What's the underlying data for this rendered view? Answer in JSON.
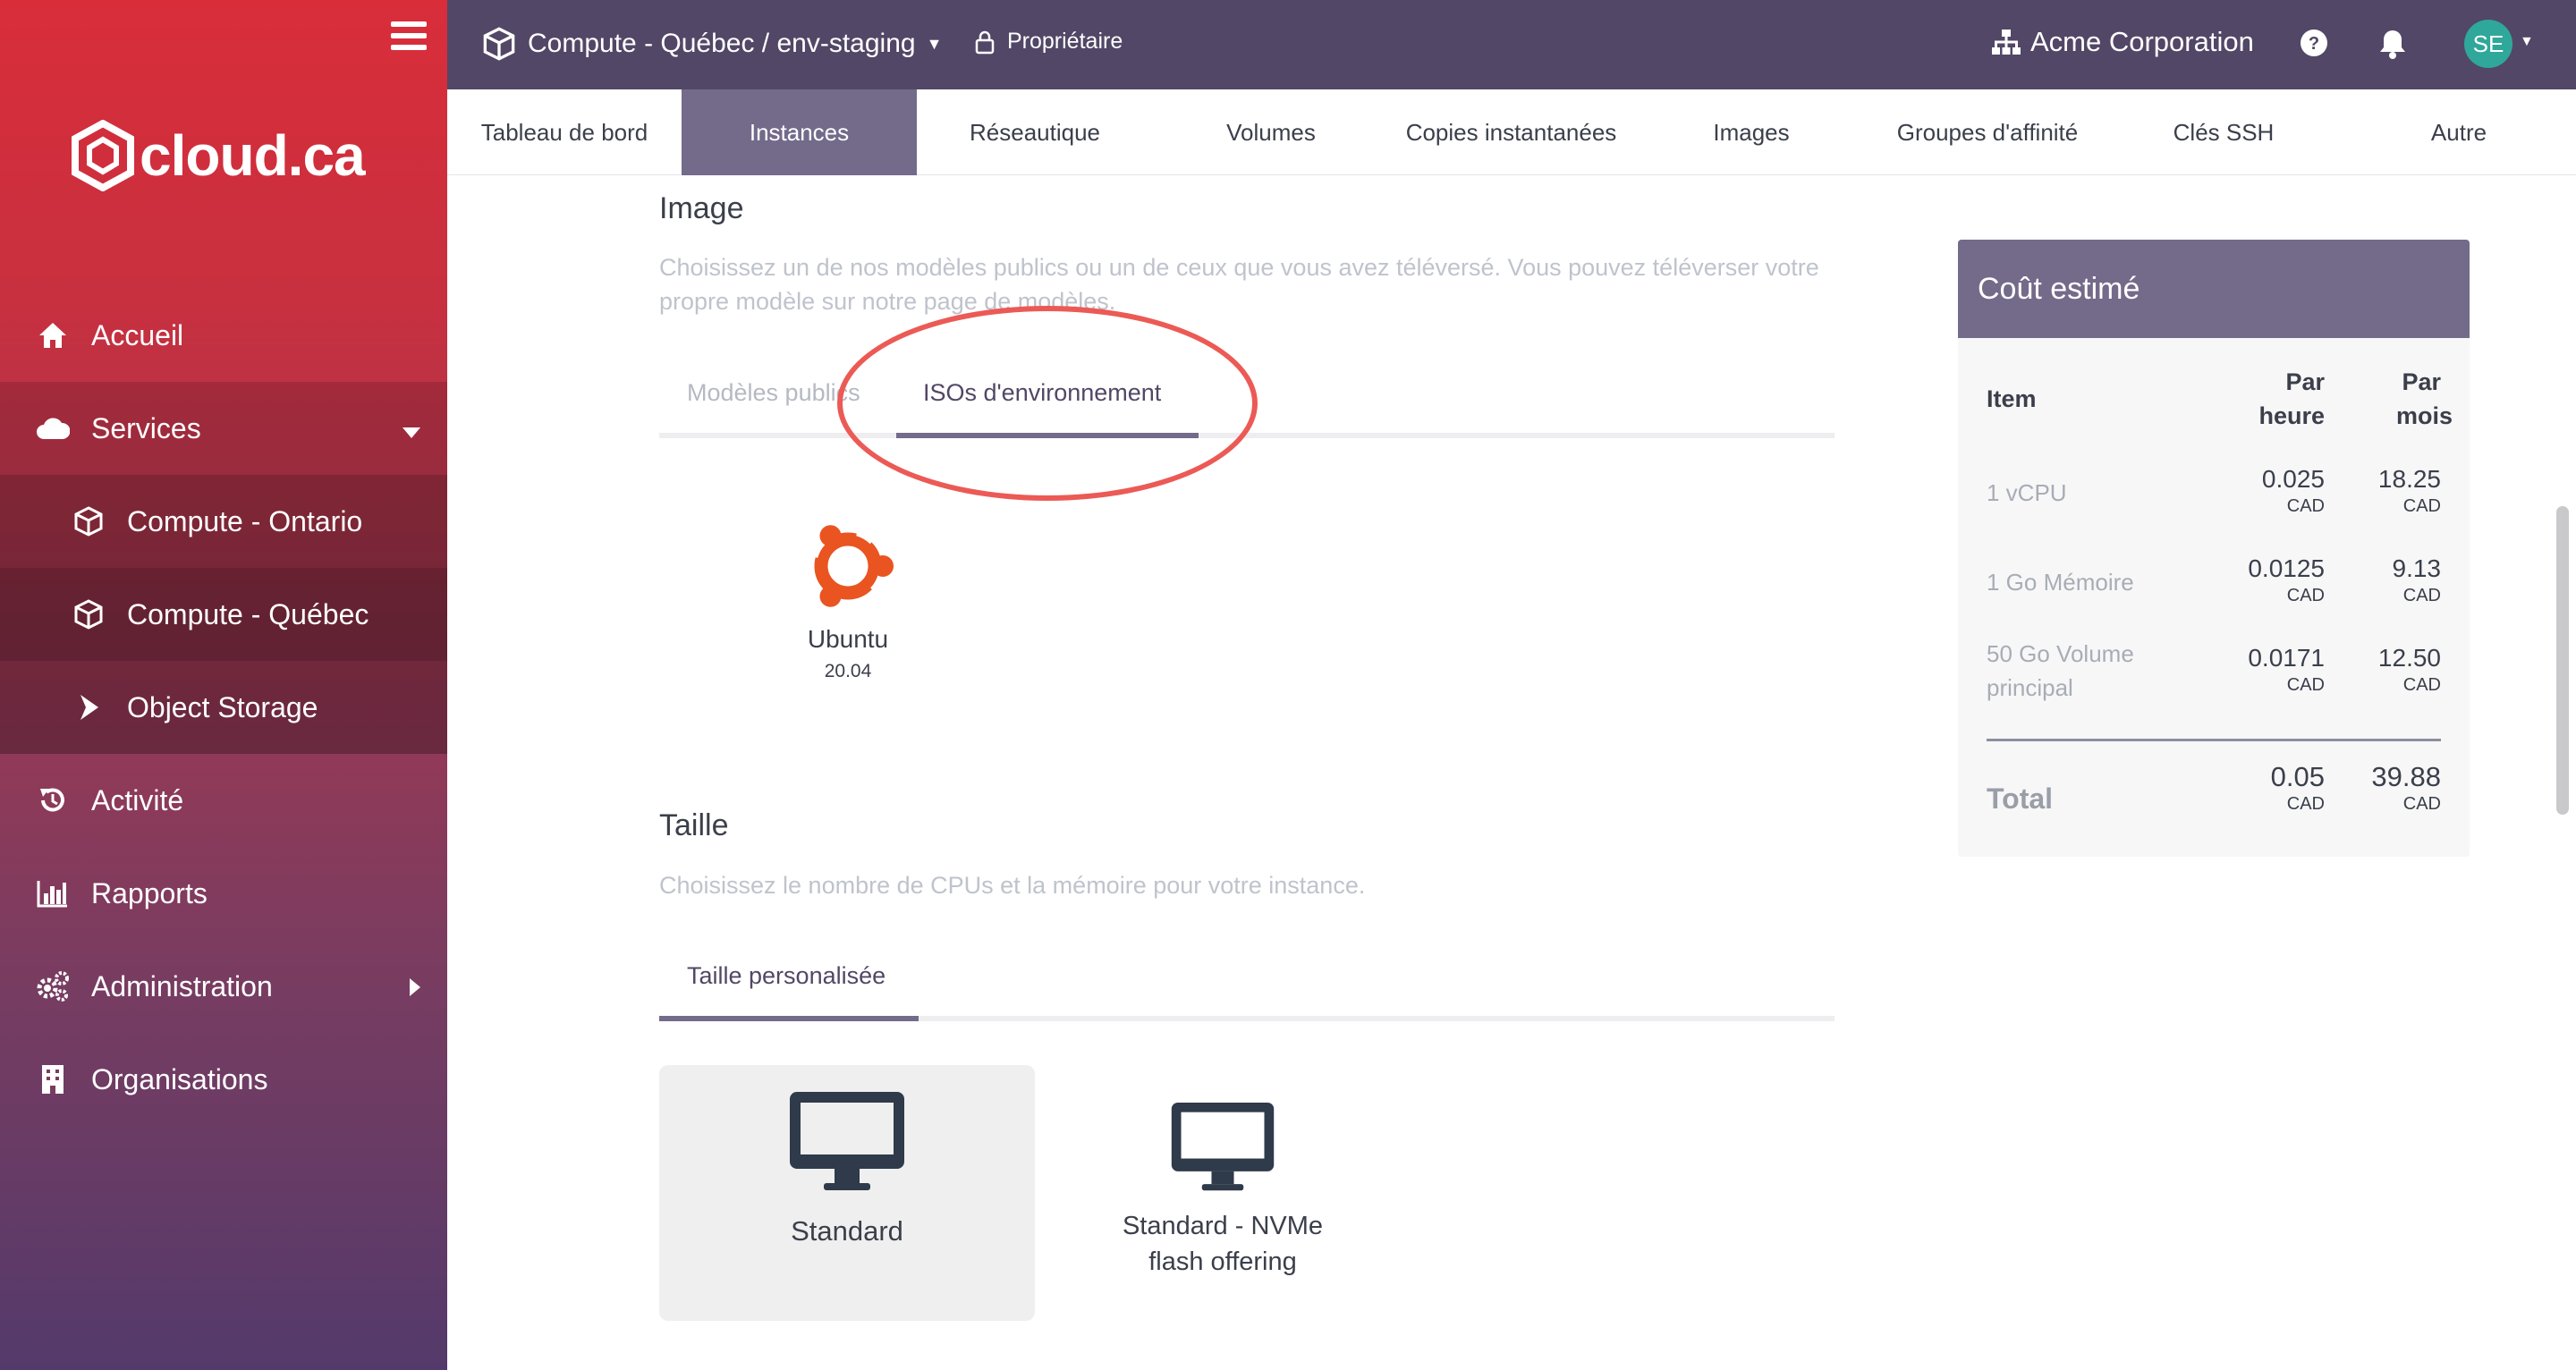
{
  "sidebar": {
    "logo_text": "cloud.ca",
    "items": [
      {
        "label": "Accueil",
        "icon": "home-icon"
      },
      {
        "label": "Services",
        "icon": "cloud-icon"
      },
      {
        "label": "Compute - Ontario",
        "icon": "cube-icon"
      },
      {
        "label": "Compute - Québec",
        "icon": "cube-icon"
      },
      {
        "label": "Object Storage",
        "icon": "arrow-right-icon"
      },
      {
        "label": "Activité",
        "icon": "history-icon"
      },
      {
        "label": "Rapports",
        "icon": "bar-chart-icon"
      },
      {
        "label": "Administration",
        "icon": "gears-icon"
      },
      {
        "label": "Organisations",
        "icon": "building-icon"
      }
    ]
  },
  "topbar": {
    "breadcrumb": "Compute - Québec / env-staging",
    "role": "Propriétaire",
    "organization": "Acme Corporation",
    "avatar_initials": "SE"
  },
  "tabs": [
    "Tableau de bord",
    "Instances",
    "Réseautique",
    "Volumes",
    "Copies instantanées",
    "Images",
    "Groupes d'affinité",
    "Clés SSH",
    "Autre"
  ],
  "image_section": {
    "title": "Image",
    "description": "Choisissez un de nos modèles publics ou un de ceux que vous avez téléversé. Vous pouvez téléverser votre propre modèle sur notre page de modèles.",
    "tabs": [
      "Modèles publics",
      "ISOs d'environnement"
    ],
    "iso": {
      "name": "Ubuntu",
      "version": "20.04"
    }
  },
  "size_section": {
    "title": "Taille",
    "description": "Choisissez le nombre de CPUs et la mémoire pour votre instance.",
    "tab": "Taille personalisée",
    "options": [
      "Standard",
      "Standard - NVMe flash offering"
    ]
  },
  "cost": {
    "title": "Coût estimé",
    "headers": {
      "item": "Item",
      "hour": "Par heure",
      "month": "Par mois"
    },
    "rows": [
      {
        "item": "1 vCPU",
        "hour": "0.025",
        "month": "18.25",
        "currency": "CAD"
      },
      {
        "item": "1 Go Mémoire",
        "hour": "0.0125",
        "month": "9.13",
        "currency": "CAD"
      },
      {
        "item": "50 Go Volume principal",
        "hour": "0.0171",
        "month": "12.50",
        "currency": "CAD"
      }
    ],
    "total": {
      "label": "Total",
      "hour": "0.05",
      "month": "39.88",
      "currency": "CAD"
    }
  },
  "colors": {
    "sidebar_top": "#d92d3a",
    "sidebar_bottom": "#543a6b",
    "topbar": "#524766",
    "accent": "#746a8a",
    "annotation": "#ec5a55",
    "avatar": "#2fa79a",
    "ubuntu": "#e95420"
  }
}
